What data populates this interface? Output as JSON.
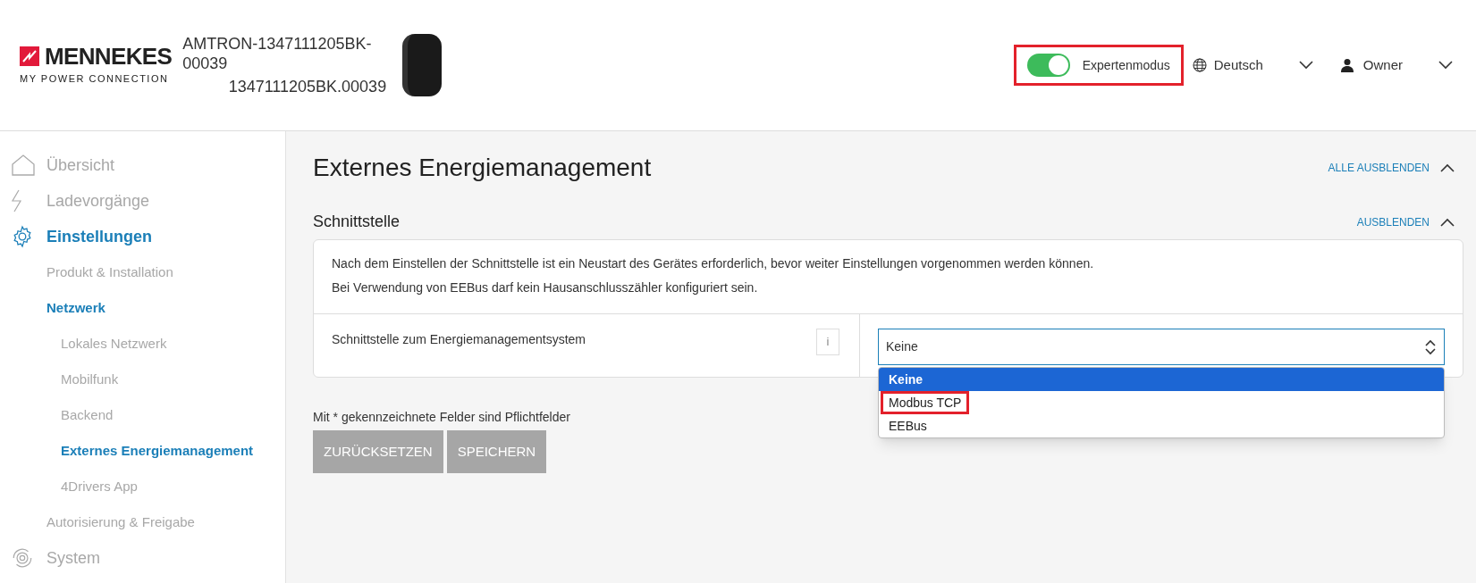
{
  "header": {
    "logo": {
      "brand": "MENNEKES",
      "tagline": "MY POWER CONNECTION"
    },
    "device_name": "AMTRON-1347111205BK-00039",
    "device_serial": "1347111205BK.00039",
    "expert_mode": {
      "label": "Expertenmodus",
      "on": true,
      "highlighted": true
    },
    "language": "Deutsch",
    "user": "Owner"
  },
  "sidebar": {
    "items": [
      {
        "label": "Übersicht",
        "selected": false
      },
      {
        "label": "Ladevorgänge",
        "selected": false
      },
      {
        "label": "Einstellungen",
        "selected": true,
        "children": [
          {
            "label": "Produkt & Installation",
            "selected": false
          },
          {
            "label": "Netzwerk",
            "selected": true,
            "children": [
              {
                "label": "Lokales Netzwerk",
                "selected": false
              },
              {
                "label": "Mobilfunk",
                "selected": false
              },
              {
                "label": "Backend",
                "selected": false
              },
              {
                "label": "Externes Energiemanagement",
                "selected": true
              },
              {
                "label": "4Drivers App",
                "selected": false
              }
            ]
          },
          {
            "label": "Autorisierung & Freigabe",
            "selected": false
          }
        ]
      },
      {
        "label": "System",
        "selected": false
      }
    ]
  },
  "main": {
    "title": "Externes Energiemanagement",
    "collapse_all": "ALLE AUSBLENDEN",
    "section": {
      "title": "Schnittstelle",
      "collapse": "AUSBLENDEN",
      "notes": [
        "Nach dem Einstellen der Schnittstelle ist ein Neustart des Gerätes erforderlich, bevor weiter Einstellungen vorgenommen werden können.",
        "Bei Verwendung von EEBus darf kein Hausanschlusszähler konfiguriert sein."
      ],
      "field": {
        "label": "Schnittstelle zum Energiemanagementsystem",
        "info": "i",
        "value": "Keine",
        "expanded": true,
        "options": [
          {
            "label": "Keine",
            "selected": true,
            "highlighted": false
          },
          {
            "label": "Modbus TCP",
            "selected": false,
            "highlighted": true
          },
          {
            "label": "EEBus",
            "selected": false,
            "highlighted": false
          }
        ]
      }
    },
    "required_note": "Mit * gekennzeichnete Felder sind Pflichtfelder",
    "buttons": [
      {
        "label": "ZURÜCKSETZEN",
        "disabled": true
      },
      {
        "label": "SPEICHERN",
        "disabled": true
      }
    ]
  }
}
